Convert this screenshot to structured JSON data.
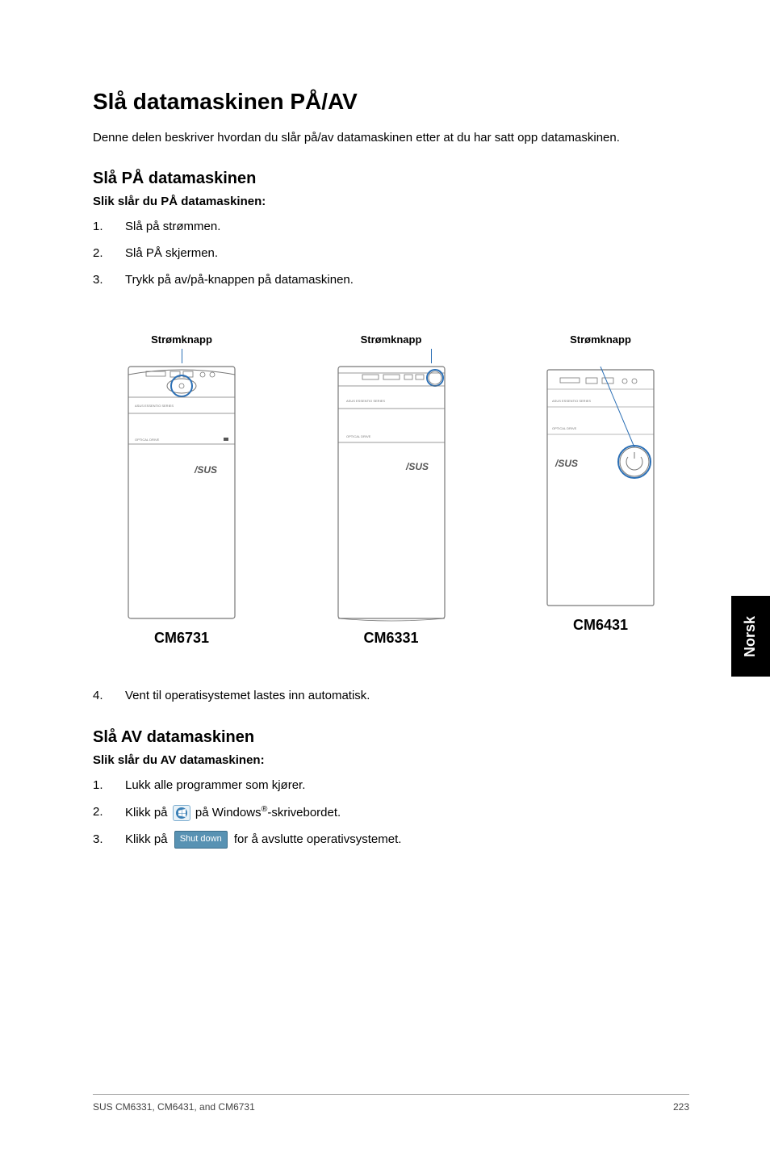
{
  "heading_main": "Slå datamaskinen PÅ/AV",
  "intro": "Denne delen beskriver hvordan du slår på/av datamaskinen etter at du har satt opp datamaskinen.",
  "section_on": {
    "title": "Slå PÅ datamaskinen",
    "subtitle": "Slik slår du PÅ datamaskinen:",
    "steps": [
      {
        "n": "1.",
        "t": "Slå på strømmen."
      },
      {
        "n": "2.",
        "t": "Slå PÅ skjermen."
      },
      {
        "n": "3.",
        "t": "Trykk på av/på-knappen på datamaskinen."
      }
    ],
    "step4": {
      "n": "4.",
      "t": "Vent til operatisystemet lastes inn automatisk."
    }
  },
  "figures": {
    "label_power": "Strømknapp",
    "models": [
      "CM6731",
      "CM6331",
      "CM6431"
    ]
  },
  "section_off": {
    "title": "Slå AV datamaskinen",
    "subtitle": "Slik slår du AV datamaskinen:",
    "steps": {
      "s1": {
        "n": "1.",
        "t": "Lukk alle programmer som kjører."
      },
      "s2": {
        "n": "2.",
        "pre": "Klikk på",
        "post_a": " på Windows",
        "post_b": "-skrivebordet."
      },
      "s3": {
        "n": "3.",
        "pre": "Klikk på",
        "btn": "Shut down",
        "post": " for å avslutte operativsystemet."
      }
    }
  },
  "side_tab": "Norsk",
  "footer": {
    "left": "SUS CM6331, CM6431, and CM6731",
    "right": "223"
  }
}
